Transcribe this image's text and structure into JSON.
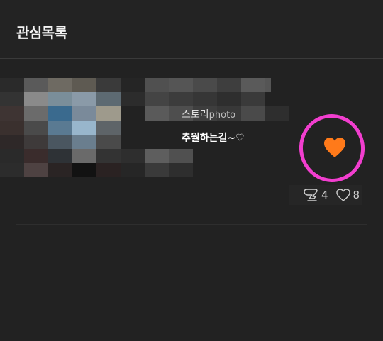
{
  "header": {
    "title": "관심목록"
  },
  "post": {
    "story_name": "스토리",
    "story_suffix": "photo",
    "title": "추월하는길~♡",
    "liked": true,
    "comment_count": "4",
    "like_count": "8"
  },
  "icons": {
    "like_button": "heart-icon",
    "comments": "comment-icon",
    "likes": "heart-outline-icon"
  },
  "colors": {
    "background": "#222222",
    "heart": "#ff7a1a",
    "annotation_ring": "#f23ecf"
  }
}
